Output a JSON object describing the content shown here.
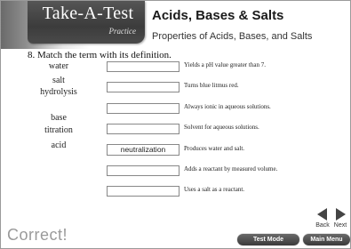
{
  "header": {
    "logo_title": "Take-A-Test",
    "logo_subtitle": "Practice",
    "title": "Acids, Bases & Salts",
    "subtitle": "Properties of Acids, Bases, and Salts"
  },
  "question": {
    "prompt": "8. Match the term with its definition.",
    "terms": [
      "water",
      "salt",
      "hydrolysis",
      "base",
      "titration",
      "acid"
    ],
    "definitions": [
      {
        "answer": "",
        "text": "Yields a pH value greater than 7."
      },
      {
        "answer": "",
        "text": "Turns blue litmus red."
      },
      {
        "answer": "",
        "text": "Always ionic in aqueous solutions."
      },
      {
        "answer": "",
        "text": "Solvent for aqueous solutions."
      },
      {
        "answer": "neutralization",
        "text": "Produces water and salt."
      },
      {
        "answer": "",
        "text": "Adds a reactant by measured volume."
      },
      {
        "answer": "",
        "text": "Uses a salt as a reactant."
      }
    ]
  },
  "footer": {
    "feedback": "Correct!",
    "back_label": "Back",
    "next_label": "Next",
    "test_mode_label": "Test Mode",
    "main_menu_label": "Main Menu"
  },
  "icons": {
    "back": "triangle-left-icon",
    "next": "triangle-right-icon"
  },
  "colors": {
    "button_dark": "#3a3a3a",
    "feedback_gray": "#9a9a9a"
  }
}
